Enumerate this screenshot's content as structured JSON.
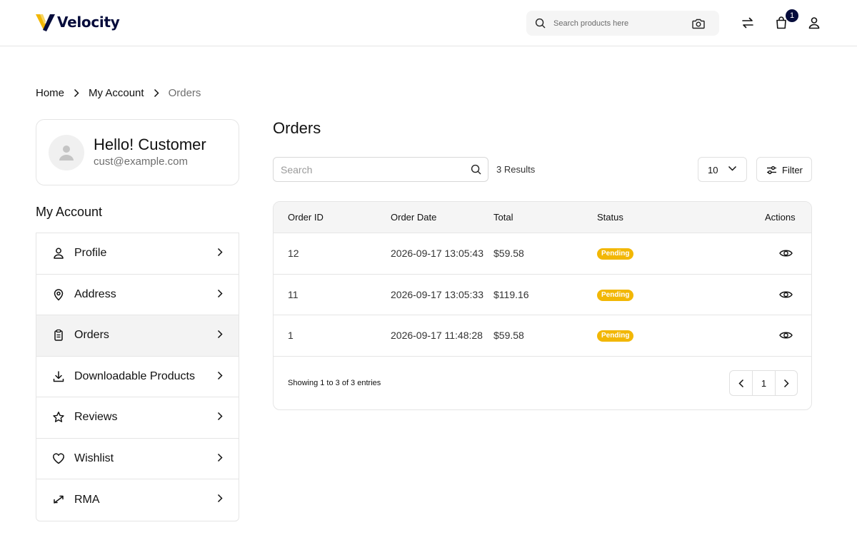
{
  "header": {
    "brand": "Velocity",
    "search_placeholder": "Search products here",
    "cart_count": "1",
    "icons": [
      "search-icon",
      "camera-icon",
      "compare-icon",
      "cart-icon",
      "user-icon"
    ]
  },
  "breadcrumb": {
    "items": [
      "Home",
      "My Account"
    ],
    "current": "Orders"
  },
  "customer": {
    "greeting": "Hello! Customer",
    "email": "cust@example.com"
  },
  "sidebar": {
    "title": "My Account",
    "items": [
      {
        "label": "Profile",
        "icon": "user-icon"
      },
      {
        "label": "Address",
        "icon": "location-icon"
      },
      {
        "label": "Orders",
        "icon": "clipboard-icon"
      },
      {
        "label": "Downloadable Products",
        "icon": "download-icon"
      },
      {
        "label": "Reviews",
        "icon": "star-icon"
      },
      {
        "label": "Wishlist",
        "icon": "heart-icon"
      },
      {
        "label": "RMA",
        "icon": "return-icon"
      }
    ],
    "active": "Orders"
  },
  "main": {
    "title": "Orders",
    "search_placeholder": "Search",
    "results": "3 Results",
    "per_page": "10",
    "filter_label": "Filter",
    "columns": [
      "Order ID",
      "Order Date",
      "Total",
      "Status",
      "Actions"
    ],
    "rows": [
      {
        "id": "12",
        "date": "2026-09-17 13:05:43",
        "total": "$59.58",
        "status": "Pending"
      },
      {
        "id": "11",
        "date": "2026-09-17 13:05:33",
        "total": "$119.16",
        "status": "Pending"
      },
      {
        "id": "1",
        "date": "2026-09-17 11:48:28",
        "total": "$59.58",
        "status": "Pending"
      }
    ],
    "showing": "Showing 1 to 3 of 3 entries",
    "current_page": "1"
  },
  "colors": {
    "brand_navy": "#060c3b",
    "brand_yellow": "#f2b705",
    "status_pending": "#f2b705"
  }
}
